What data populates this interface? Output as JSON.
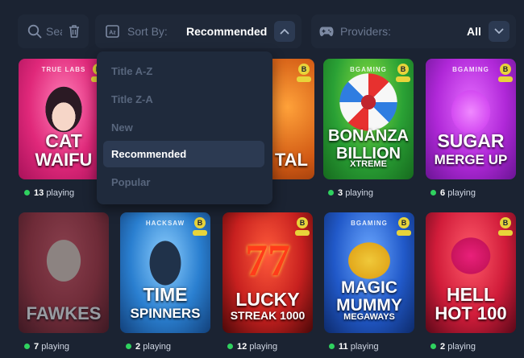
{
  "search": {
    "placeholder": "Search"
  },
  "sort": {
    "label": "Sort By:",
    "value": "Recommended",
    "options": [
      "Title A-Z",
      "Title Z-A",
      "New",
      "Recommended",
      "Popular"
    ],
    "selected": "Recommended"
  },
  "providers": {
    "label": "Providers:",
    "value": "All"
  },
  "games": [
    {
      "title_line1": "CAT",
      "title_line2": "WAIFU",
      "provider": "TRUE LABS",
      "playing_count": "13",
      "playing_suffix": "playing",
      "bg": "#e0287a"
    },
    {
      "title_line1": "",
      "title_line2": "TAL",
      "provider": "",
      "playing_count": "",
      "playing_suffix": "",
      "bg": "#d25a14"
    },
    {
      "title_line1": "BONANZA",
      "title_line2": "BILLION",
      "title_line3": "XTREME",
      "provider": "BGAMING",
      "playing_count": "3",
      "playing_suffix": "playing",
      "bg": "#2aa135"
    },
    {
      "title_line1": "SUGAR",
      "title_line2": "MERGE UP",
      "provider": "BGAMING",
      "playing_count": "6",
      "playing_suffix": "playing",
      "bg": "#b028d8"
    },
    {
      "title_line1": "",
      "title_line2": "FAWKES",
      "provider": "",
      "playing_count": "7",
      "playing_suffix": "playing",
      "bg": "#b3323d"
    },
    {
      "title_line1": "TIME",
      "title_line2": "SPINNERS",
      "provider": "HACKSAW",
      "playing_count": "2",
      "playing_suffix": "playing",
      "bg": "#2a7fd0"
    },
    {
      "title_line1": "LUCKY",
      "title_line2": "STREAK 1000",
      "provider": "",
      "playing_count": "12",
      "playing_suffix": "playing",
      "bg": "#c7201f"
    },
    {
      "title_line1": "MAGIC",
      "title_line2": "MUMMY",
      "title_line3": "MEGAWAYS",
      "provider": "BGAMING",
      "playing_count": "11",
      "playing_suffix": "playing",
      "bg": "#2159c9"
    },
    {
      "title_line1": "HELL",
      "title_line2": "HOT 100",
      "provider": "",
      "playing_count": "2",
      "playing_suffix": "playing",
      "bg": "#d11c3a"
    }
  ],
  "badge_text": "B",
  "colors": {
    "background": "#1b2332",
    "panel": "#1f2838",
    "accent_button": "#2c3a52",
    "online_dot": "#2fd25f",
    "badge": "#e8d43a"
  },
  "icons": [
    "search-icon",
    "trash-icon",
    "sort-icon",
    "chevron-down-icon",
    "gamepad-icon"
  ]
}
